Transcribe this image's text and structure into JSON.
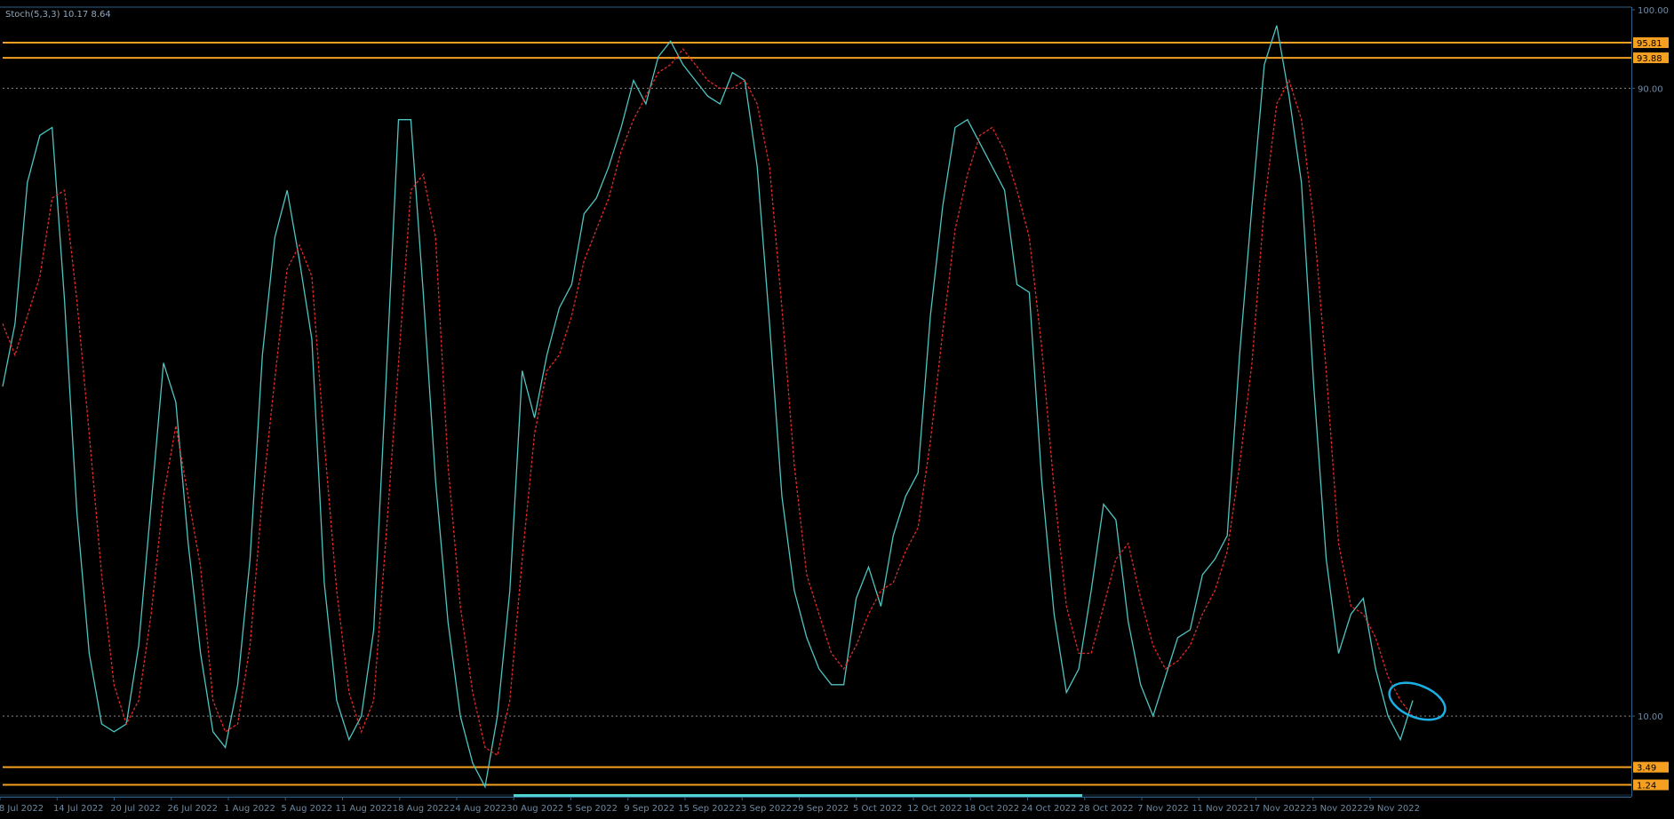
{
  "indicator": {
    "label": "Stoch(5,3,3) 10.17 8.64"
  },
  "colors": {
    "background": "#000000",
    "main_line": "#4fc4c0",
    "signal_line": "#e02a2a",
    "level_line": "#8a8a8a",
    "hline": "#f5a020",
    "axis_border": "#2f5f86",
    "highlight_ellipse": "#1ab0e6",
    "scroll_bar": "#4fd2d0"
  },
  "chart_data": {
    "type": "line",
    "ylim": [
      0,
      100
    ],
    "y_ticks": [
      "100.00",
      "90.00",
      "10.00"
    ],
    "level_lines": [
      90,
      10
    ],
    "horizontal_lines": [
      {
        "label": "95.81",
        "value": 95.81
      },
      {
        "label": "93.88",
        "value": 93.88
      },
      {
        "label": "3.49",
        "value": 3.49
      },
      {
        "label": "1.24",
        "value": 1.24
      }
    ],
    "date_labels": [
      "8 Jul 2022",
      "14 Jul 2022",
      "20 Jul 2022",
      "26 Jul 2022",
      "1 Aug 2022",
      "5 Aug 2022",
      "11 Aug 2022",
      "18 Aug 2022",
      "24 Aug 2022",
      "30 Aug 2022",
      "5 Sep 2022",
      "9 Sep 2022",
      "15 Sep 2022",
      "23 Sep 2022",
      "29 Sep 2022",
      "5 Oct 2022",
      "12 Oct 2022",
      "18 Oct 2022",
      "24 Oct 2022",
      "28 Oct 2022",
      "7 Nov 2022",
      "11 Nov 2022",
      "17 Nov 2022",
      "23 Nov 2022",
      "29 Nov 2022"
    ],
    "series": [
      {
        "values": [
          52,
          60,
          78,
          84,
          85,
          63,
          36,
          18,
          9,
          8,
          9,
          19,
          37,
          55,
          50,
          32,
          18,
          8,
          6,
          14,
          30,
          56,
          71,
          77,
          68,
          58,
          27,
          12,
          7,
          10,
          21,
          53,
          86,
          86,
          64,
          40,
          22,
          10,
          4,
          1,
          10,
          26,
          54,
          48,
          56,
          62,
          65,
          74,
          76,
          80,
          85,
          91,
          88,
          94,
          96,
          93,
          91,
          89,
          88,
          92,
          91,
          80,
          60,
          38,
          26,
          20,
          16,
          14,
          14,
          25,
          29,
          24,
          33,
          38,
          41,
          61,
          75,
          85,
          86,
          83,
          80,
          77,
          65,
          64,
          40,
          23,
          13,
          16,
          26,
          37,
          35,
          22,
          14,
          10,
          15,
          20,
          21,
          28,
          30,
          33,
          56,
          75,
          93,
          98,
          89,
          78,
          52,
          30,
          18,
          23,
          25,
          16,
          10,
          7,
          12
        ]
      },
      {
        "values": [
          60,
          56,
          61,
          66,
          76,
          77,
          63,
          46,
          28,
          14,
          9,
          12,
          23,
          38,
          47,
          38,
          29,
          12,
          8,
          9,
          19,
          38,
          53,
          67,
          70,
          66,
          45,
          26,
          13,
          8,
          12,
          33,
          55,
          77,
          79,
          71,
          42,
          24,
          13,
          6,
          5,
          12,
          30,
          46,
          54,
          56,
          61,
          68,
          72,
          76,
          82,
          86,
          89,
          92,
          93,
          95,
          93,
          91,
          90,
          90,
          91,
          88,
          80,
          62,
          42,
          28,
          23,
          18,
          16,
          19,
          23,
          26,
          27,
          31,
          34,
          45,
          59,
          72,
          79,
          84,
          85,
          82,
          77,
          71,
          57,
          39,
          24,
          18,
          18,
          24,
          30,
          32,
          25,
          19,
          16,
          17,
          19,
          23,
          26,
          31,
          42,
          55,
          75,
          88,
          91,
          86,
          73,
          54,
          32,
          24,
          23,
          20,
          15,
          12,
          10
        ]
      }
    ]
  }
}
